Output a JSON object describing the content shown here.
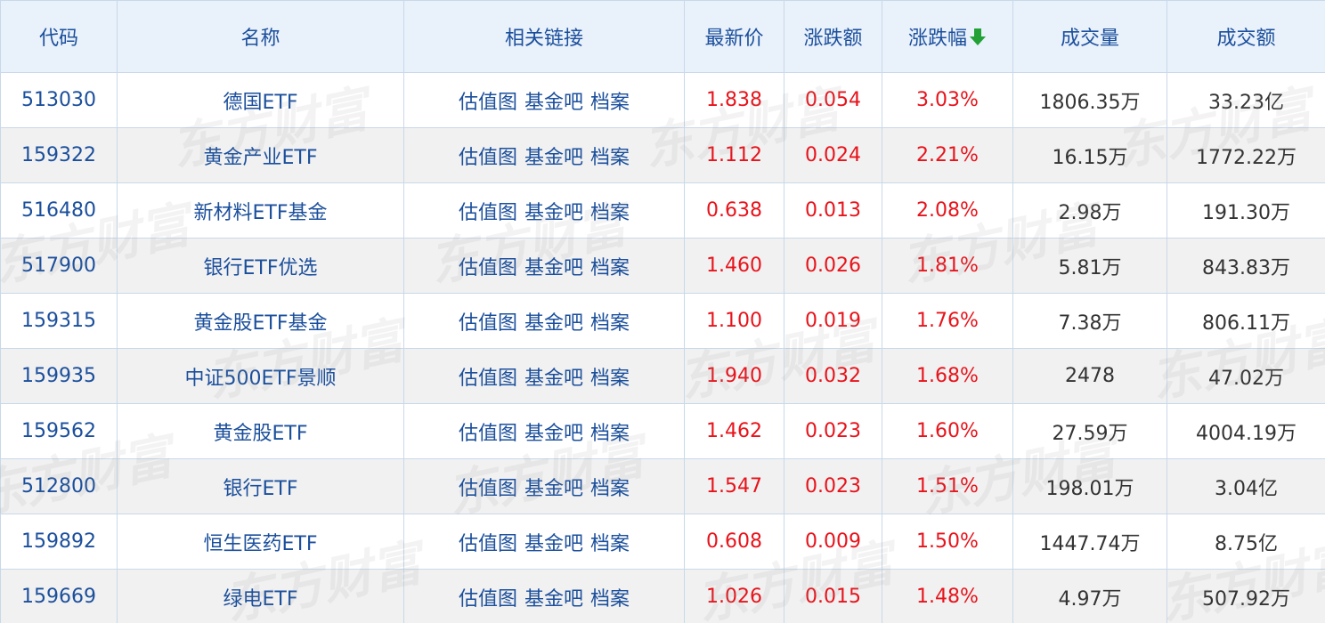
{
  "header": {
    "code": "代码",
    "name": "名称",
    "links": "相关链接",
    "price": "最新价",
    "change": "涨跌额",
    "change_pct": "涨跌幅",
    "volume": "成交量",
    "turnover": "成交额"
  },
  "sort_icon": "arrow-down-icon",
  "watermark": "东方财富",
  "links": [
    "估值图",
    "基金吧",
    "档案"
  ],
  "colors": {
    "header_bg": "#e9f1fb",
    "header_text": "#1b4f9c",
    "blue": "#1b4f9c",
    "red": "#e8131b",
    "sort_green": "#22a236",
    "border": "#c9d8ea"
  },
  "rows": [
    {
      "code": "513030",
      "name": "德国ETF",
      "price": "1.838",
      "change": "0.054",
      "change_pct": "3.03%",
      "volume": "1806.35万",
      "turnover": "33.23亿"
    },
    {
      "code": "159322",
      "name": "黄金产业ETF",
      "price": "1.112",
      "change": "0.024",
      "change_pct": "2.21%",
      "volume": "16.15万",
      "turnover": "1772.22万"
    },
    {
      "code": "516480",
      "name": "新材料ETF基金",
      "price": "0.638",
      "change": "0.013",
      "change_pct": "2.08%",
      "volume": "2.98万",
      "turnover": "191.30万"
    },
    {
      "code": "517900",
      "name": "银行ETF优选",
      "price": "1.460",
      "change": "0.026",
      "change_pct": "1.81%",
      "volume": "5.81万",
      "turnover": "843.83万"
    },
    {
      "code": "159315",
      "name": "黄金股ETF基金",
      "price": "1.100",
      "change": "0.019",
      "change_pct": "1.76%",
      "volume": "7.38万",
      "turnover": "806.11万"
    },
    {
      "code": "159935",
      "name": "中证500ETF景顺",
      "price": "1.940",
      "change": "0.032",
      "change_pct": "1.68%",
      "volume": "2478",
      "turnover": "47.02万"
    },
    {
      "code": "159562",
      "name": "黄金股ETF",
      "price": "1.462",
      "change": "0.023",
      "change_pct": "1.60%",
      "volume": "27.59万",
      "turnover": "4004.19万"
    },
    {
      "code": "512800",
      "name": "银行ETF",
      "price": "1.547",
      "change": "0.023",
      "change_pct": "1.51%",
      "volume": "198.01万",
      "turnover": "3.04亿"
    },
    {
      "code": "159892",
      "name": "恒生医药ETF",
      "price": "0.608",
      "change": "0.009",
      "change_pct": "1.50%",
      "volume": "1447.74万",
      "turnover": "8.75亿"
    },
    {
      "code": "159669",
      "name": "绿电ETF",
      "price": "1.026",
      "change": "0.015",
      "change_pct": "1.48%",
      "volume": "4.97万",
      "turnover": "507.92万"
    }
  ]
}
